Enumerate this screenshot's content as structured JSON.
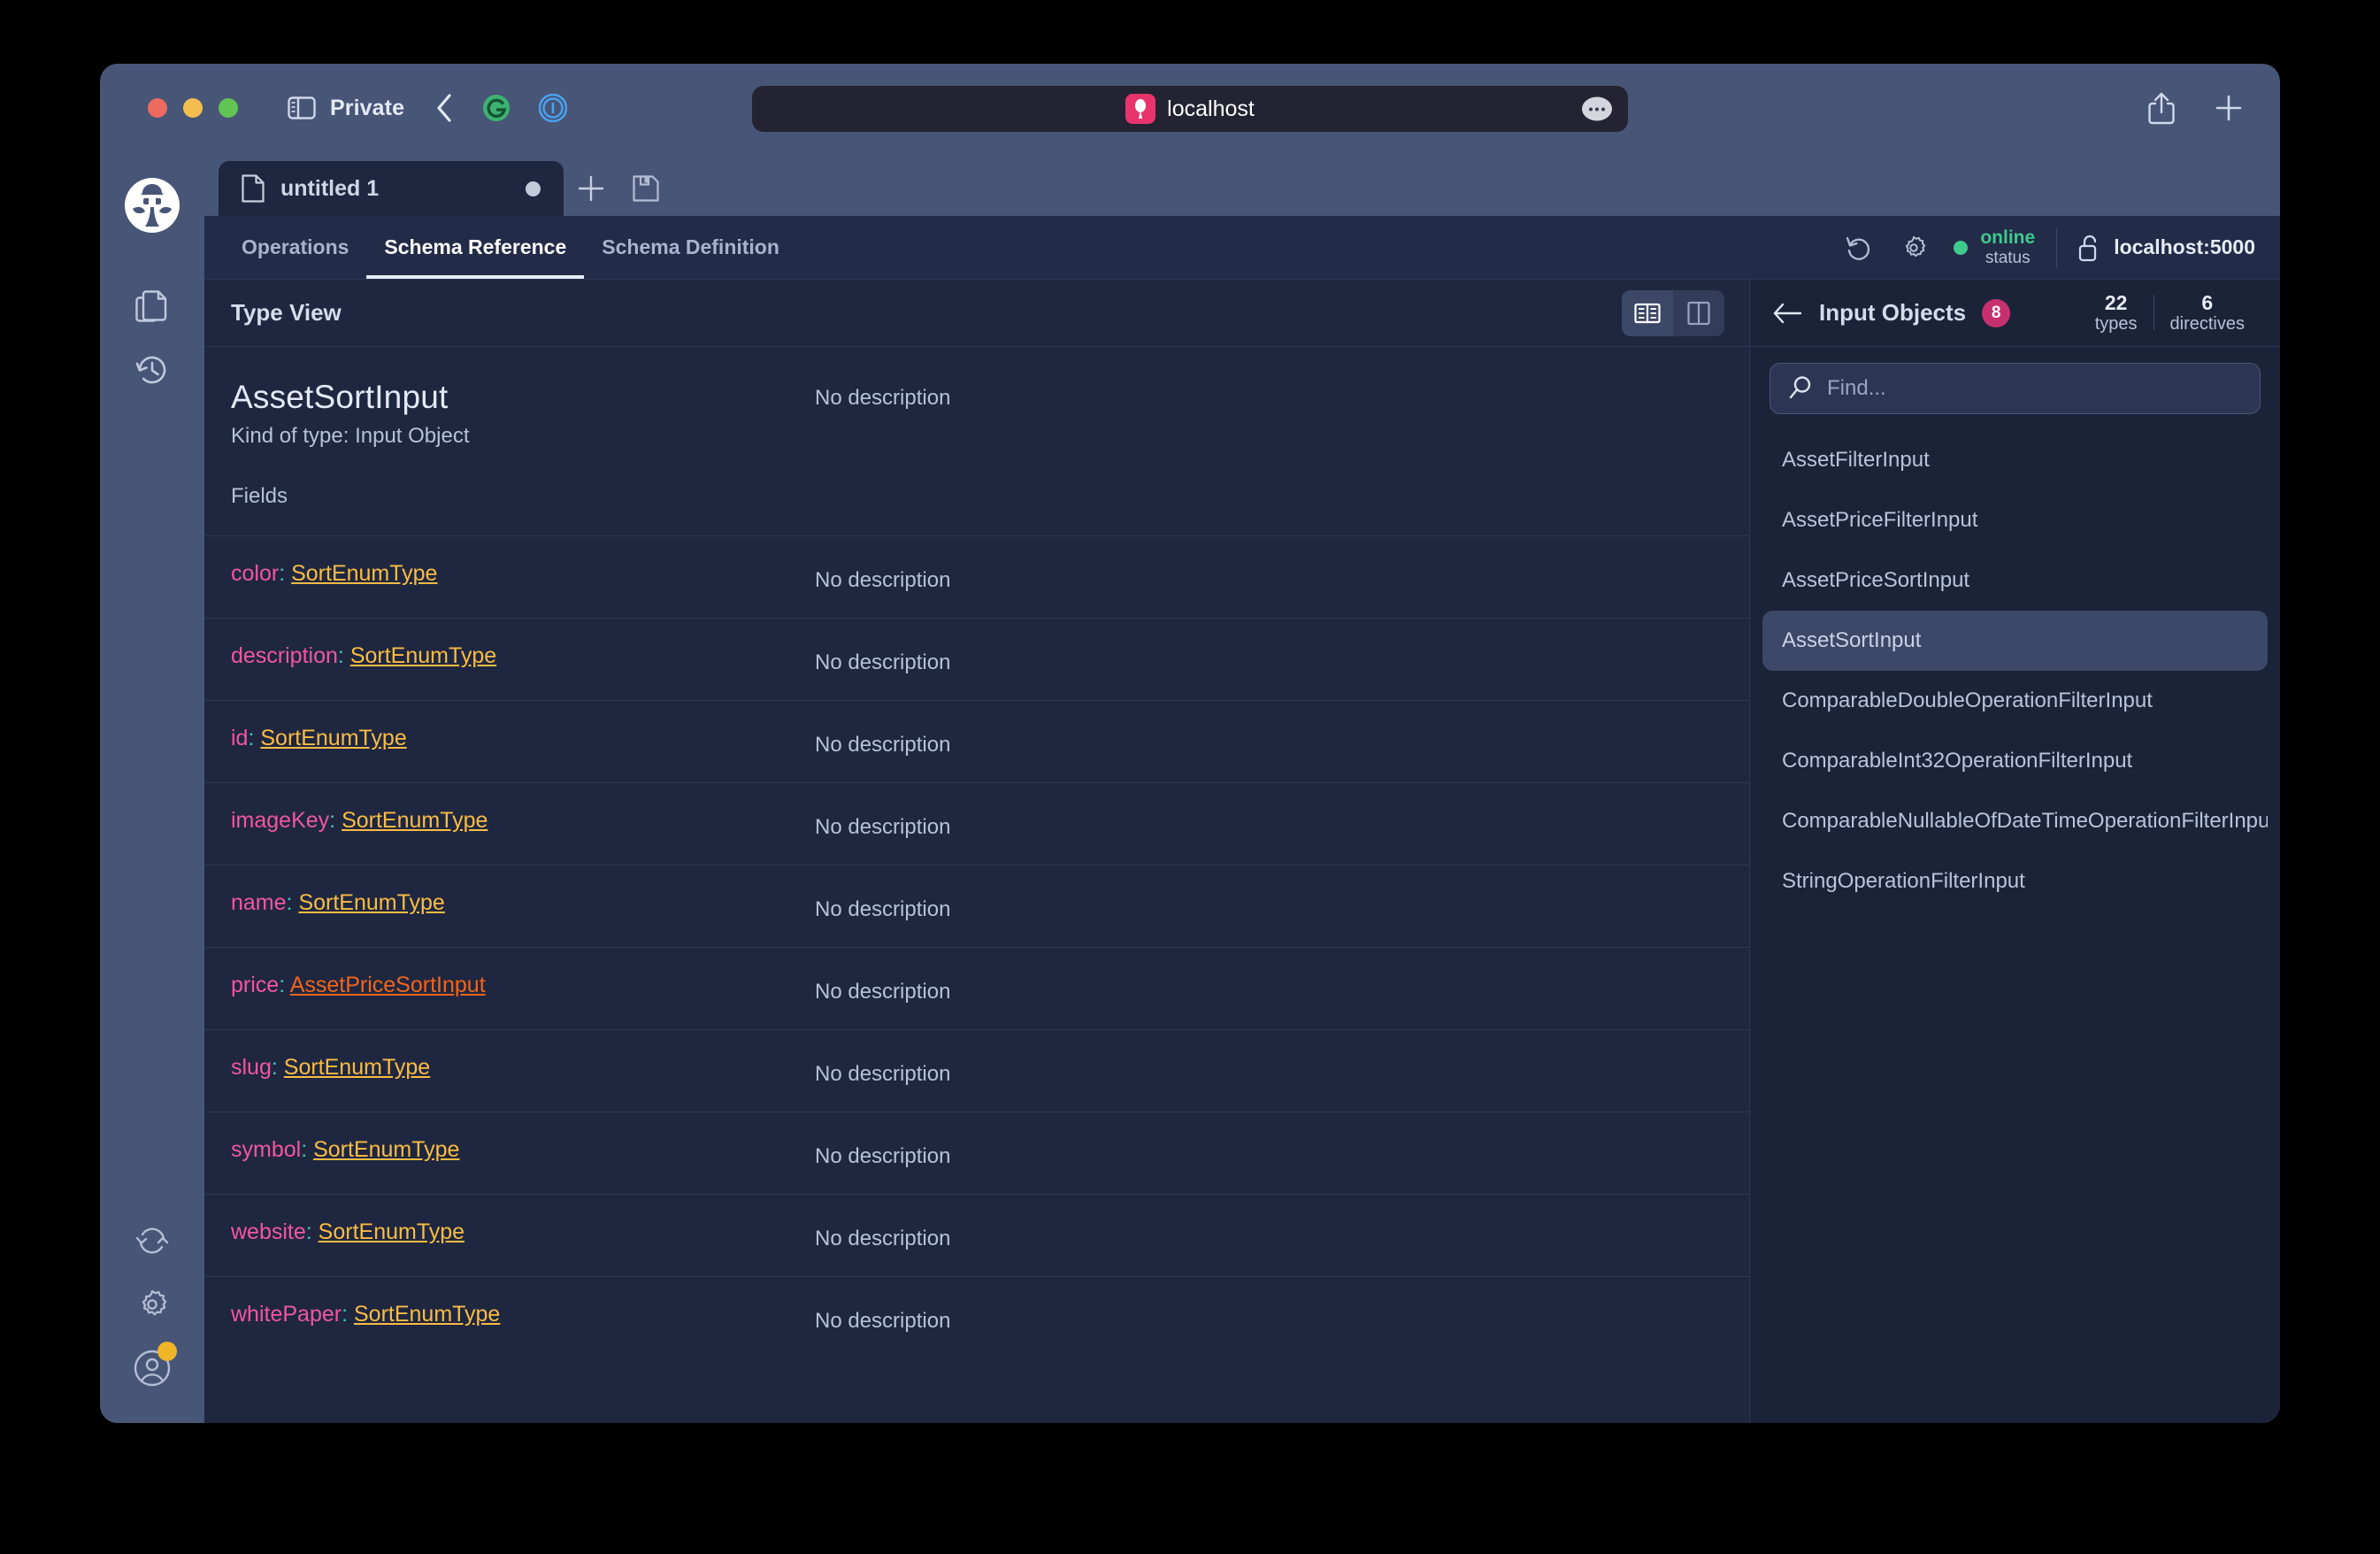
{
  "browser": {
    "privacy_label": "Private",
    "url": "localhost",
    "icons": {
      "sidebar": "sidebar-toggle-icon",
      "back": "back-chevron-icon",
      "grammarly": "grammarly-extension-icon",
      "onepassword": "1password-extension-icon",
      "more": "url-more-icon",
      "share": "share-icon",
      "newtab": "plus-icon"
    }
  },
  "rail": {
    "logo": "banana-cake-pop-logo",
    "items": [
      {
        "name": "documents-icon"
      },
      {
        "name": "history-icon"
      }
    ],
    "bottom_items": [
      {
        "name": "sync-icon"
      },
      {
        "name": "settings-gear-icon"
      },
      {
        "name": "user-avatar-icon"
      }
    ]
  },
  "tabstrip": {
    "doc_tab": {
      "title": "untitled 1",
      "dirty": true,
      "icon": "document-icon"
    },
    "new_tab_label": "+",
    "save_icon": "save-floppy-icon"
  },
  "navbar": {
    "tabs": [
      {
        "label": "Operations",
        "active": false
      },
      {
        "label": "Schema Reference",
        "active": true
      },
      {
        "label": "Schema Definition",
        "active": false
      }
    ],
    "refresh_icon": "refresh-icon",
    "settings_icon": "settings-gear-icon",
    "status": {
      "state": "online",
      "word": "status"
    },
    "lock_icon": "unlocked-padlock-icon",
    "endpoint": "localhost:5000"
  },
  "typeview": {
    "header_title": "Type View",
    "view_modes": [
      {
        "name": "book-view-icon",
        "active": true
      },
      {
        "name": "column-view-icon",
        "active": false
      }
    ],
    "type_name": "AssetSortInput",
    "kind": "Kind of type: Input Object",
    "type_description": "No description",
    "fields_label": "Fields",
    "fields": [
      {
        "name": "color",
        "type": "SortEnumType",
        "type_kind": "enum",
        "description": "No description"
      },
      {
        "name": "description",
        "type": "SortEnumType",
        "type_kind": "enum",
        "description": "No description"
      },
      {
        "name": "id",
        "type": "SortEnumType",
        "type_kind": "enum",
        "description": "No description"
      },
      {
        "name": "imageKey",
        "type": "SortEnumType",
        "type_kind": "enum",
        "description": "No description"
      },
      {
        "name": "name",
        "type": "SortEnumType",
        "type_kind": "enum",
        "description": "No description"
      },
      {
        "name": "price",
        "type": "AssetPriceSortInput",
        "type_kind": "object",
        "description": "No description"
      },
      {
        "name": "slug",
        "type": "SortEnumType",
        "type_kind": "enum",
        "description": "No description"
      },
      {
        "name": "symbol",
        "type": "SortEnumType",
        "type_kind": "enum",
        "description": "No description"
      },
      {
        "name": "website",
        "type": "SortEnumType",
        "type_kind": "enum",
        "description": "No description"
      },
      {
        "name": "whitePaper",
        "type": "SortEnumType",
        "type_kind": "enum",
        "description": "No description"
      }
    ]
  },
  "explorer": {
    "back_icon": "back-arrow-icon",
    "title": "Input Objects",
    "count": "8",
    "stats": [
      {
        "num": "22",
        "label": "types"
      },
      {
        "num": "6",
        "label": "directives"
      }
    ],
    "search": {
      "value": "",
      "placeholder": "Find...",
      "icon": "search-icon"
    },
    "items": [
      {
        "label": "AssetFilterInput",
        "active": false
      },
      {
        "label": "AssetPriceFilterInput",
        "active": false
      },
      {
        "label": "AssetPriceSortInput",
        "active": false
      },
      {
        "label": "AssetSortInput",
        "active": true
      },
      {
        "label": "ComparableDoubleOperationFilterInput",
        "active": false
      },
      {
        "label": "ComparableInt32OperationFilterInput",
        "active": false
      },
      {
        "label": "ComparableNullableOfDateTimeOperationFilterInput",
        "active": false
      },
      {
        "label": "StringOperationFilterInput",
        "active": false
      }
    ]
  },
  "colors": {
    "accent_pink": "#f0579f",
    "accent_teal": "#46c6b5",
    "accent_amber": "#fbbc42",
    "accent_orange": "#f2641b",
    "status_green": "#3fca8e",
    "badge_pink": "#c7306f",
    "chrome_blue": "#475577",
    "app_bg": "#1f2740"
  }
}
